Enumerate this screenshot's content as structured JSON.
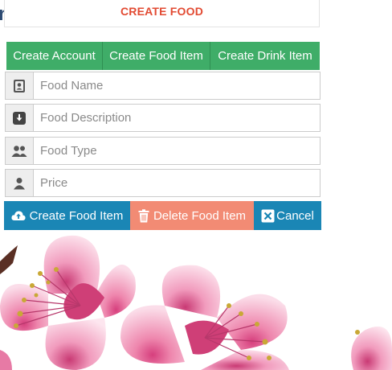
{
  "header": {
    "title": "CREATE FOOD"
  },
  "tabs": [
    {
      "label": "Create Account"
    },
    {
      "label": "Create Food Item"
    },
    {
      "label": "Create Drink Item"
    }
  ],
  "form": {
    "food_name": {
      "placeholder": "Food Name",
      "value": ""
    },
    "food_description": {
      "placeholder": "Food Description",
      "value": ""
    },
    "food_type": {
      "placeholder": "Food Type",
      "value": ""
    },
    "price": {
      "placeholder": "Price",
      "value": ""
    }
  },
  "actions": {
    "create_label": "Create Food Item",
    "delete_label": "Delete Food Item",
    "cancel_label": "Cancel"
  },
  "colors": {
    "title": "#e24a32",
    "tab_bg": "#3fad68",
    "primary_button": "#1a86b5",
    "danger_button": "#f28b74"
  },
  "icons": {
    "food_name": "id-card-icon",
    "food_description": "download-box-icon",
    "food_type": "users-icon",
    "price": "user-icon",
    "create": "cloud-upload-icon",
    "delete": "trash-icon",
    "cancel": "close-box-icon"
  }
}
